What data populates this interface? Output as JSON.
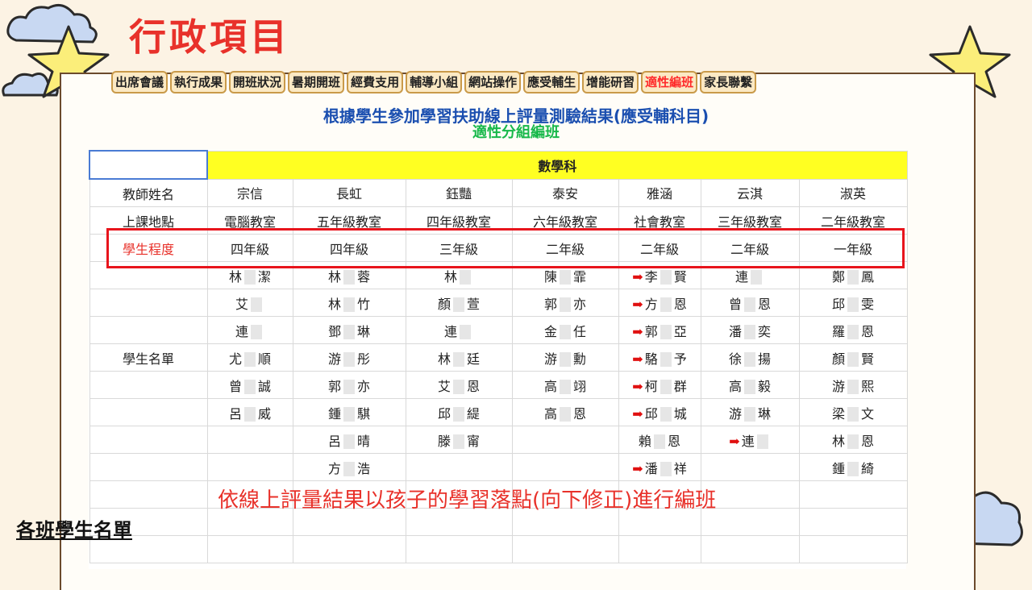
{
  "title": "行政項目",
  "tabs": [
    "出席會議",
    "執行成果",
    "開班狀況",
    "暑期開班",
    "經費支用",
    "輔導小組",
    "網站操作",
    "應受輔生",
    "增能研習",
    "適性編班",
    "家長聯繫"
  ],
  "active_tab": "適性編班",
  "subtitle1": "根據學生參加學習扶助線上評量測驗結果(應受輔科目)",
  "subtitle2": "適性分組編班",
  "sheet": {
    "subject": "數學科",
    "row_labels": {
      "teacher": "教師姓名",
      "location": "上課地點",
      "level": "學生程度",
      "students": "學生名單"
    },
    "teachers": [
      "宗信",
      "長虹",
      "鈺豔",
      "泰安",
      "雅涵",
      "云淇",
      "淑英"
    ],
    "locations": [
      "電腦教室",
      "五年級教室",
      "四年級教室",
      "六年級教室",
      "社會教室",
      "三年級教室",
      "二年級教室"
    ],
    "levels": [
      "四年級",
      "四年級",
      "三年級",
      "二年級",
      "二年級",
      "二年級",
      "一年級"
    ],
    "student_rows": [
      [
        "林 潔",
        "林 蓉",
        "林",
        "陳 霏",
        "李 賢",
        "連",
        "鄭 鳳"
      ],
      [
        "艾",
        "林 竹",
        "顏 萱",
        "郭 亦",
        "方 恩",
        "曾 恩",
        "邱 雯"
      ],
      [
        "連",
        "鄧 琳",
        "連",
        "金 任",
        "郭 亞",
        "潘 奕",
        "羅 恩"
      ],
      [
        "尤 順",
        "游 彤",
        "林 廷",
        "游 勳",
        "駱 予",
        "徐 揚",
        "顏 賢"
      ],
      [
        "曾 誠",
        "郭 亦",
        "艾 恩",
        "高 翊",
        "柯 群",
        "高 毅",
        "游 熙"
      ],
      [
        "呂 威",
        "鍾 騏",
        "邱 緹",
        "高 恩",
        "邱 城",
        "游 琳",
        "梁 文"
      ],
      [
        "",
        "呂 晴",
        "滕 甯",
        "",
        "賴 恩",
        "連",
        "林 恩"
      ],
      [
        "",
        "方 浩",
        "",
        "",
        "潘 祥",
        "",
        "鍾 綺"
      ]
    ]
  },
  "note": "依線上評量結果以孩子的學習落點(向下修正)進行編班",
  "caption": "各班學生名單",
  "colors": {
    "title": "#e8312a",
    "subtitle1": "#1b4fb0",
    "subtitle2": "#17b84a",
    "highlight": "#e8141c",
    "subject_bg": "#ffff22"
  }
}
